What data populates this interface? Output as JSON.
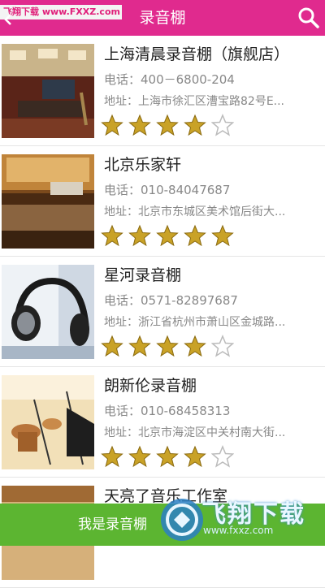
{
  "header": {
    "watermark": "飞翔下载 www.FXXZ.com",
    "title": "录音棚"
  },
  "items": [
    {
      "name": "上海清晨录音棚（旗舰店）",
      "phone": "电话：400－6800-204",
      "address": "地址：上海市徐汇区漕宝路82号E...",
      "rating": 4
    },
    {
      "name": "北京乐家轩",
      "phone": "电话：010-84047687",
      "address": "地址：北京市东城区美术馆后街大...",
      "rating": 5
    },
    {
      "name": "星河录音棚",
      "phone": "电话：0571-82897687",
      "address": "地址：浙江省杭州市萧山区金城路...",
      "rating": 4
    },
    {
      "name": "朗新伦录音棚",
      "phone": "电话：010-68458313",
      "address": "地址：北京市海淀区中关村南大街...",
      "rating": 4
    },
    {
      "name": "天亮了音乐工作室",
      "phone": "",
      "address": "",
      "rating": 0
    }
  ],
  "bottom": {
    "label": "我是录音棚",
    "watermark": "飞翔下载",
    "watermark_sub": "www.fxxz.com"
  },
  "colors": {
    "header": "#e02a8e",
    "bottom_bar": "#5cb531",
    "star_filled": "#c9a227",
    "star_empty": "#bbbbbb"
  }
}
